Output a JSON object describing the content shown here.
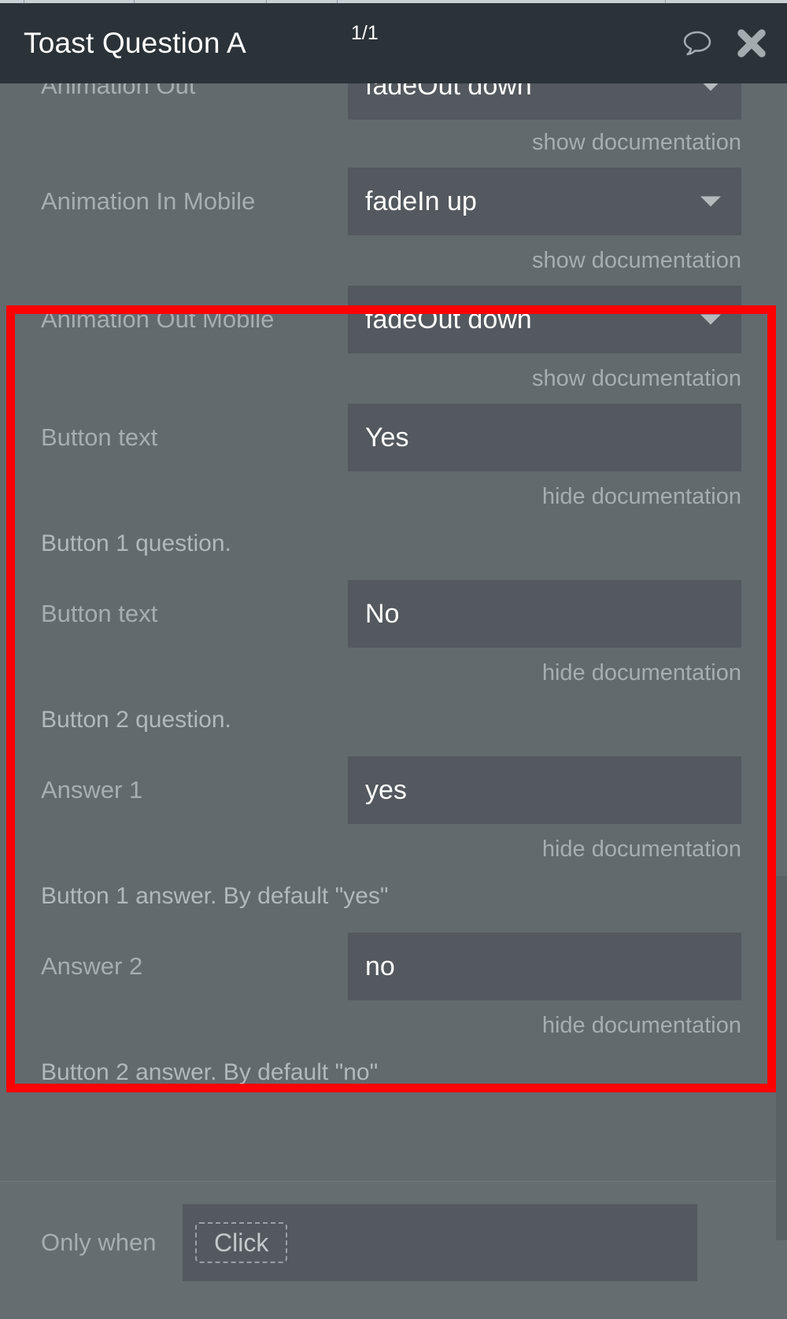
{
  "header": {
    "title": "Toast Question A",
    "counter": "1/1",
    "comment_icon": "speech-bubble-icon",
    "close_icon": "close-icon"
  },
  "colors": {
    "highlight_border": "#ff0000",
    "panel_bg": "#626a6e",
    "field_bg": "#53595e",
    "header_bg": "#2b3338",
    "label_text": "#a7aeb1",
    "value_text": "#ffffff"
  },
  "rows": [
    {
      "label": "Animation Out",
      "value": "fadeOut down",
      "type": "select",
      "doc_toggle": "show documentation",
      "doc_text": null
    },
    {
      "label": "Animation In Mobile",
      "value": "fadeIn up",
      "type": "select",
      "doc_toggle": "show documentation",
      "doc_text": null
    },
    {
      "label": "Animation Out Mobile",
      "value": "fadeOut down",
      "type": "select",
      "doc_toggle": "show documentation",
      "doc_text": null
    },
    {
      "label": "Button text",
      "value": "Yes",
      "type": "text",
      "doc_toggle": "hide documentation",
      "doc_text": "Button 1 question."
    },
    {
      "label": "Button text",
      "value": "No",
      "type": "text",
      "doc_toggle": "hide documentation",
      "doc_text": "Button 2 question."
    },
    {
      "label": "Answer 1",
      "value": "yes",
      "type": "text",
      "doc_toggle": "hide documentation",
      "doc_text": "Button 1 answer. By default \"yes\""
    },
    {
      "label": "Answer 2",
      "value": "no",
      "type": "text",
      "doc_toggle": "hide documentation",
      "doc_text": "Button 2 answer. By default \"no\""
    }
  ],
  "bottom": {
    "only_when_label": "Only when",
    "only_when_chip": "Click"
  }
}
